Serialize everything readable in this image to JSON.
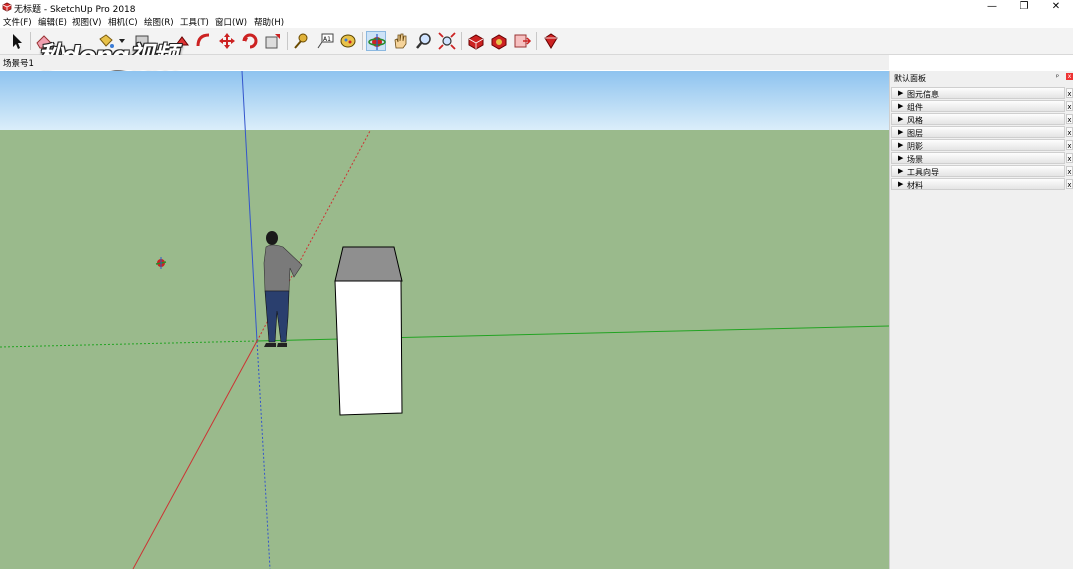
{
  "window": {
    "title": "无标题 - SketchUp Pro 2018",
    "controls": [
      "—",
      "❐",
      "✕"
    ]
  },
  "menu": [
    "文件(F)",
    "编辑(E)",
    "视图(V)",
    "相机(C)",
    "绘图(R)",
    "工具(T)",
    "窗口(W)",
    "帮助(H)"
  ],
  "toolbar": {
    "tools": [
      "select",
      "eraser",
      "paint-bucket",
      "line",
      "rectangle",
      "push-pull",
      "offset",
      "move",
      "rotate",
      "scale",
      "tape-measure",
      "text",
      "paint",
      "orbit",
      "pan",
      "zoom",
      "zoom-extents",
      "3d-warehouse",
      "extension-warehouse",
      "send-to-layout",
      "extension-manager"
    ],
    "active_tool": "orbit"
  },
  "scenes": {
    "tab": "场景号1"
  },
  "watermark": "秒dong视频",
  "tray": {
    "title": "默认面板",
    "pin": "ᵖ",
    "close": "x",
    "panels": [
      "图元信息",
      "组件",
      "风格",
      "图层",
      "阴影",
      "场景",
      "工具向导",
      "材料"
    ],
    "panel_close": "x"
  },
  "colors": {
    "sky_top": "#8ec3ef",
    "sky_bottom": "#dbeefa",
    "ground": "#9aba8c",
    "axis_red": "#cc3333",
    "axis_green": "#22a322",
    "axis_blue": "#3355cc",
    "box_top": "#8f8f8f",
    "box_face": "#ffffff"
  }
}
